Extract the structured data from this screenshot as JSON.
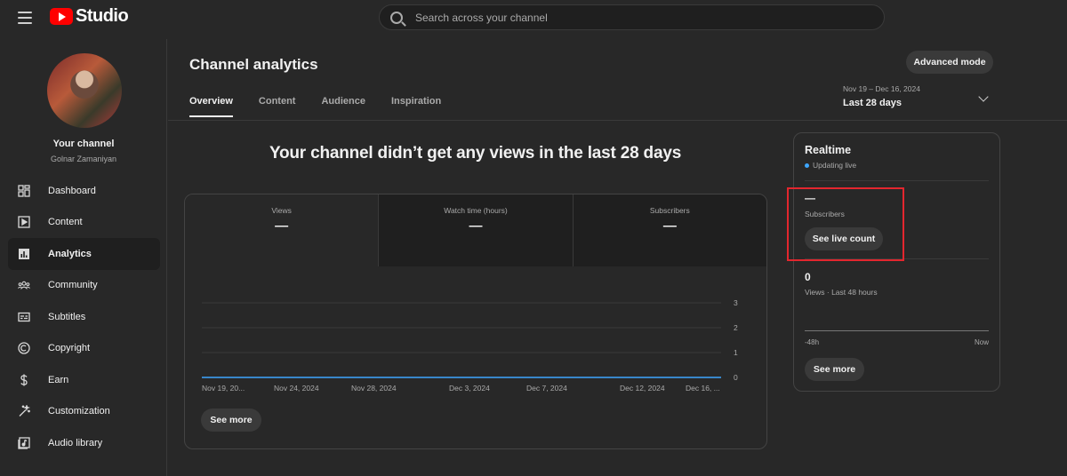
{
  "app": {
    "logo_text": "Studio"
  },
  "search": {
    "placeholder": "Search across your channel"
  },
  "sidebar": {
    "channel_title": "Your channel",
    "channel_name": "Golnar Zamaniyan",
    "items": [
      {
        "label": "Dashboard",
        "icon": "dashboard-icon"
      },
      {
        "label": "Content",
        "icon": "content-icon"
      },
      {
        "label": "Analytics",
        "icon": "analytics-icon",
        "active": true
      },
      {
        "label": "Community",
        "icon": "community-icon"
      },
      {
        "label": "Subtitles",
        "icon": "subtitles-icon"
      },
      {
        "label": "Copyright",
        "icon": "copyright-icon"
      },
      {
        "label": "Earn",
        "icon": "earn-icon"
      },
      {
        "label": "Customization",
        "icon": "customization-icon"
      },
      {
        "label": "Audio library",
        "icon": "audio-library-icon"
      }
    ]
  },
  "header": {
    "title": "Channel analytics",
    "advanced_label": "Advanced mode",
    "tabs": [
      "Overview",
      "Content",
      "Audience",
      "Inspiration"
    ],
    "active_tab": "Overview",
    "date_sub": "Nov 19 – Dec 16, 2024",
    "date_main": "Last 28 days"
  },
  "overview": {
    "headline": "Your channel didn’t get any views in the last 28 days",
    "metrics": [
      {
        "label": "Views",
        "value": "—"
      },
      {
        "label": "Watch time (hours)",
        "value": "—"
      },
      {
        "label": "Subscribers",
        "value": "—"
      }
    ],
    "see_more_label": "See more"
  },
  "chart_data": {
    "type": "line",
    "x": [
      "Nov 19, 20...",
      "Nov 24, 2024",
      "Nov 28, 2024",
      "Dec 3, 2024",
      "Dec 7, 2024",
      "Dec 12, 2024",
      "Dec 16, ..."
    ],
    "series": [
      {
        "values": [
          0,
          0,
          0,
          0,
          0,
          0,
          0
        ],
        "color": "#3ea6ff"
      }
    ],
    "y_ticks": [
      0,
      1,
      2,
      3
    ],
    "ylim": [
      0,
      3
    ],
    "grid": true,
    "xlabel": "",
    "ylabel": "",
    "title": ""
  },
  "realtime": {
    "title": "Realtime",
    "status": "Updating live",
    "subscribers_value": "—",
    "subscribers_label": "Subscribers",
    "live_count_label": "See live count",
    "views_value": "0",
    "views_label": "Views · Last 48 hours",
    "axis_start": "-48h",
    "axis_end": "Now",
    "see_more_label": "See more",
    "accent_color": "#3ea6ff",
    "highlight_color": "#e3262e"
  }
}
